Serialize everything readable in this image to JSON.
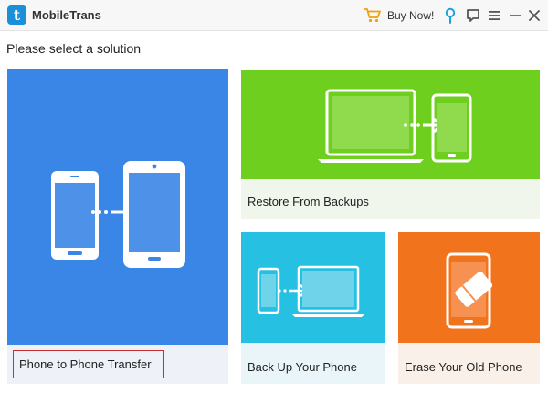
{
  "app": {
    "title": "MobileTrans",
    "logo_letter": "t",
    "buy_now_label": "Buy Now!"
  },
  "header": {
    "subtitle": "Please select a solution"
  },
  "solutions": [
    {
      "id": "phone-to-phone",
      "label": "Phone to Phone Transfer",
      "color": "#3a86e6",
      "selected": true
    },
    {
      "id": "restore",
      "label": "Restore From Backups",
      "color": "#6fcf1f",
      "selected": false
    },
    {
      "id": "backup",
      "label": "Back Up Your Phone",
      "color": "#26c1e2",
      "selected": false
    },
    {
      "id": "erase",
      "label": "Erase Your Old Phone",
      "color": "#f1731c",
      "selected": false
    }
  ],
  "colors": {
    "selection_border": "#c9302c",
    "brand": "#1b8fd8",
    "cart_accent": "#f0a20b",
    "pin_accent": "#1aa3d9"
  },
  "icons": {
    "cart": "cart-icon",
    "pin": "pin-icon",
    "chat": "chat-icon",
    "menu": "menu-icon",
    "minimize": "minimize-icon",
    "close": "close-icon"
  }
}
